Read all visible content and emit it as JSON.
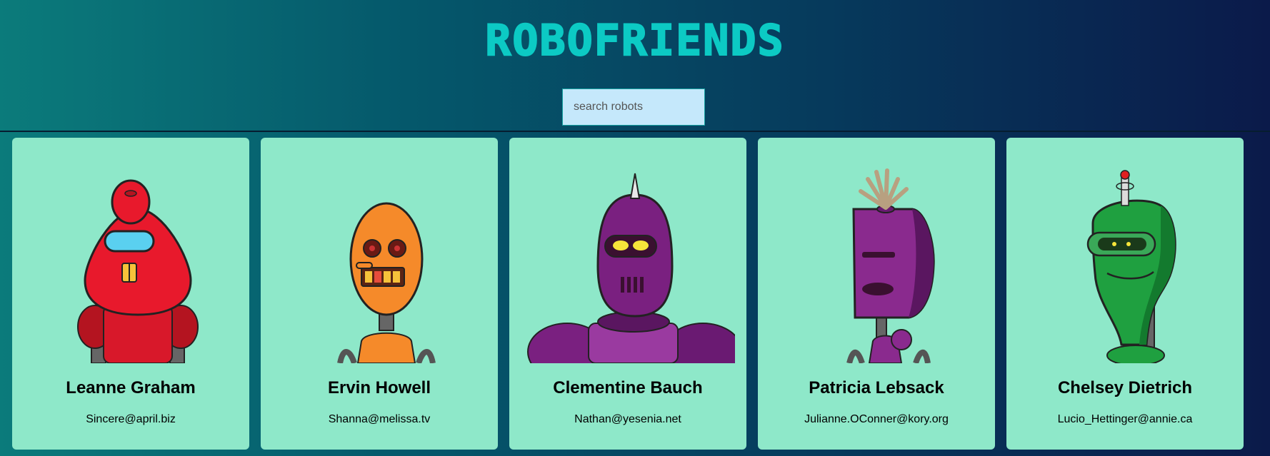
{
  "app": {
    "title": "ROBOFRIENDS"
  },
  "search": {
    "placeholder": "search robots",
    "value": ""
  },
  "robots": [
    {
      "name": "Leanne Graham",
      "email": "Sincere@april.biz",
      "color": "#e8192c"
    },
    {
      "name": "Ervin Howell",
      "email": "Shanna@melissa.tv",
      "color": "#f58a2a"
    },
    {
      "name": "Clementine Bauch",
      "email": "Nathan@yesenia.net",
      "color": "#7a2080"
    },
    {
      "name": "Patricia Lebsack",
      "email": "Julianne.OConner@kory.org",
      "color": "#8a2a8e"
    },
    {
      "name": "Chelsey Dietrich",
      "email": "Lucio_Hettinger@annie.ca",
      "color": "#1fa040"
    }
  ]
}
